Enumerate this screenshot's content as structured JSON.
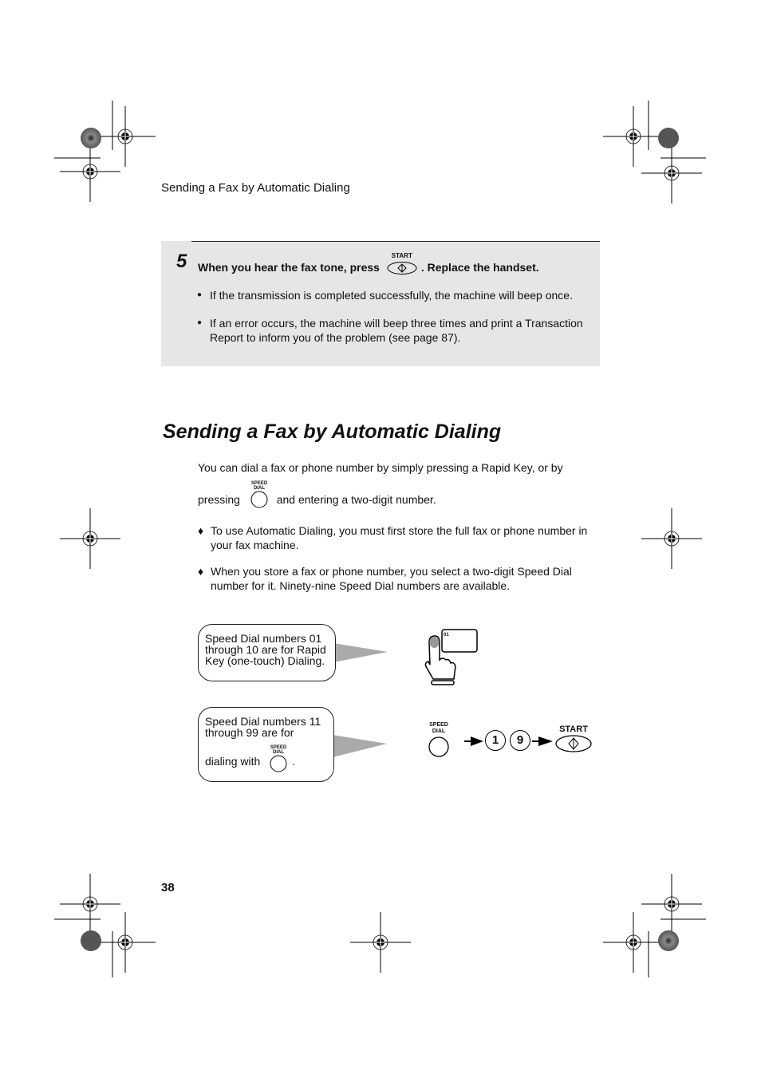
{
  "header": {
    "running_title": "Sending a Fax by Automatic Dialing"
  },
  "step5": {
    "number": "5",
    "text_before": "When you hear the fax tone, press",
    "button_label": "START",
    "text_after": ". Replace the handset.",
    "bullets": [
      "If the transmission is completed successfully, the machine will beep once.",
      "If an error occurs, the machine will beep three times and print a Transaction Report to inform you of the problem (see page 87)."
    ],
    "bullet_glyph": "●"
  },
  "section": {
    "heading": "Sending a Fax by Automatic Dialing",
    "intro_line1": "You can dial a fax or phone number by simply pressing a Rapid Key, or by",
    "intro_line2_before": "pressing",
    "intro_line2_after": "and entering a two-digit number.",
    "speed_dial_label_top": "SPEED",
    "speed_dial_label_bottom": "DIAL",
    "diamond_glyph": "♦",
    "diamond_bullets": [
      "To use Automatic Dialing, you must first store the full fax or phone number in your fax machine.",
      "When you store a fax or phone number, you select a two-digit Speed Dial number for it. Ninety-nine Speed Dial numbers are available."
    ]
  },
  "illustration": {
    "callout1": "Speed Dial numbers 01 through 10 are for Rapid Key (one-touch) Dialing.",
    "callout2_line1": "Speed Dial numbers 11 through 99 are for",
    "callout2_line2": "dialing with",
    "callout2_end": ".",
    "rapid_key_label": "01",
    "sequence": {
      "speed_dial_top": "SPEED",
      "speed_dial_bottom": "DIAL",
      "digit1": "1",
      "digit2": "9",
      "start_label": "START"
    }
  },
  "footer": {
    "page_number": "38"
  }
}
